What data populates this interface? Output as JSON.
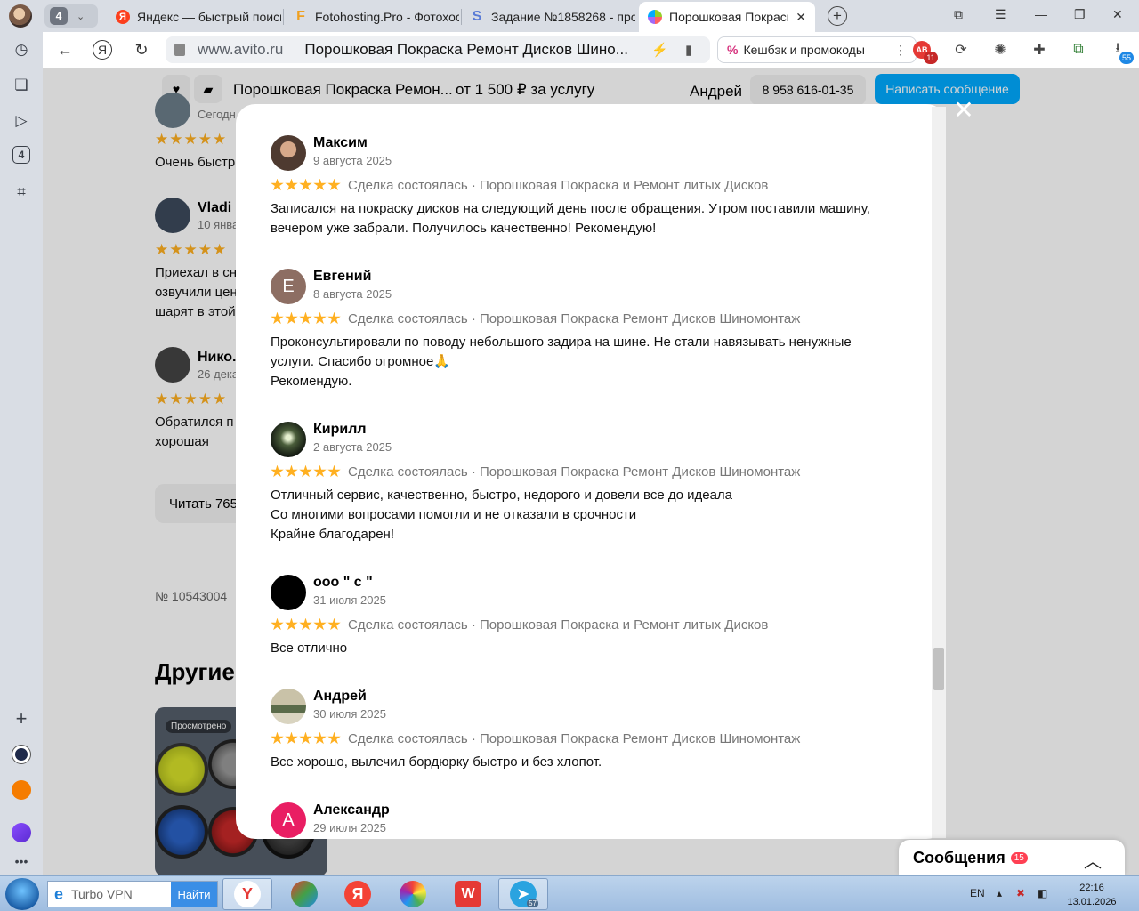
{
  "browser": {
    "tab_count": "4",
    "tabs": [
      {
        "title": "Яндекс — быстрый поиск",
        "favicon": "Я"
      },
      {
        "title": "Fotohosting.Pro - Фотохос",
        "favicon": "F"
      },
      {
        "title": "Задание №1858268 - про",
        "favicon": "S"
      },
      {
        "title": "Порошковая Покраска",
        "favicon": "avito"
      }
    ],
    "url_domain": "www.avito.ru",
    "page_title": "Порошковая Покраска Ремонт Дисков Шино...",
    "cashback_label": "Кешбэк и промокоды",
    "ext_badge_1": "11",
    "ext_badge_2": "55",
    "side_badge": "4"
  },
  "header": {
    "title": "Порошковая Покраска Ремон...",
    "price": "от 1 500 ₽ за услугу",
    "seller": "Андрей",
    "phone": "8 958 616-01-35",
    "message_button": "Написать сообщение"
  },
  "background": {
    "date_1": "Сегодн",
    "text_1": "Очень быстр",
    "name_2": "Vladi",
    "date_2": "10 янва",
    "text_2": [
      "Приехал в сн",
      "озвучили цен",
      "шарят в этой"
    ],
    "name_3": "Нико.",
    "date_3": "26 декаб",
    "text_3": [
      "Обратился п",
      "хорошая"
    ],
    "read_button": "Читать 765",
    "listing_number": "№ 10543004",
    "other_heading": "Другие",
    "card_badge": "Просмотрено"
  },
  "reviews": [
    {
      "name": "Максим",
      "date": "9 августа 2025",
      "rating": 5,
      "deal": "Сделка состоялась · Порошковая Покраска и Ремонт литых Дисков",
      "lines": [
        "Записался на покраску дисков на следующий день после обращения. Утром поставили машину,",
        "вечером уже забрали. Получилось качественно! Рекомендую!"
      ]
    },
    {
      "name": "Евгений",
      "date": "8 августа 2025",
      "rating": 5,
      "avatar_letter": "Е",
      "deal": "Сделка состоялась · Порошковая Покраска Ремонт Дисков Шиномонтаж",
      "lines": [
        "Проконсультировали по поводу небольшого задира на шине. Не стали навязывать ненужные",
        "услуги. Спасибо огромное🙏",
        "Рекомендую."
      ]
    },
    {
      "name": "Кирилл",
      "date": "2 августа 2025",
      "rating": 5,
      "deal": "Сделка состоялась · Порошковая Покраска Ремонт Дисков Шиномонтаж",
      "lines": [
        "Отличный сервис, качественно, быстро, недорого и довели все до идеала",
        "Со многими вопросами помогли и не отказали в срочности",
        "Крайне благодарен!"
      ]
    },
    {
      "name": "ооо \" с \"",
      "date": "31 июля 2025",
      "rating": 5,
      "deal": "Сделка состоялась · Порошковая Покраска и Ремонт литых Дисков",
      "lines": [
        "Все отлично"
      ]
    },
    {
      "name": "Андрей",
      "date": "30 июля 2025",
      "rating": 5,
      "deal": "Сделка состоялась · Порошковая Покраска Ремонт Дисков Шиномонтаж",
      "lines": [
        "Все хорошо, вылечил бордюрку быстро и без хлопот."
      ]
    },
    {
      "name": "Александр",
      "date": "29 июля 2025",
      "rating": 5,
      "avatar_letter": "А",
      "deal": "",
      "lines": []
    }
  ],
  "messages_widget": {
    "label": "Сообщения",
    "count": "15"
  },
  "taskbar": {
    "search_text": "Turbo VPN",
    "search_button": "Найти",
    "telegram_badge": "57",
    "language": "EN",
    "time": "22:16",
    "date": "13.01.2026"
  },
  "colors": {
    "avito_blue": "#00aaff",
    "star": "#ffb021",
    "avatar_evgeniy": "#8d6e63",
    "avatar_aleksandr": "#e91e63"
  }
}
